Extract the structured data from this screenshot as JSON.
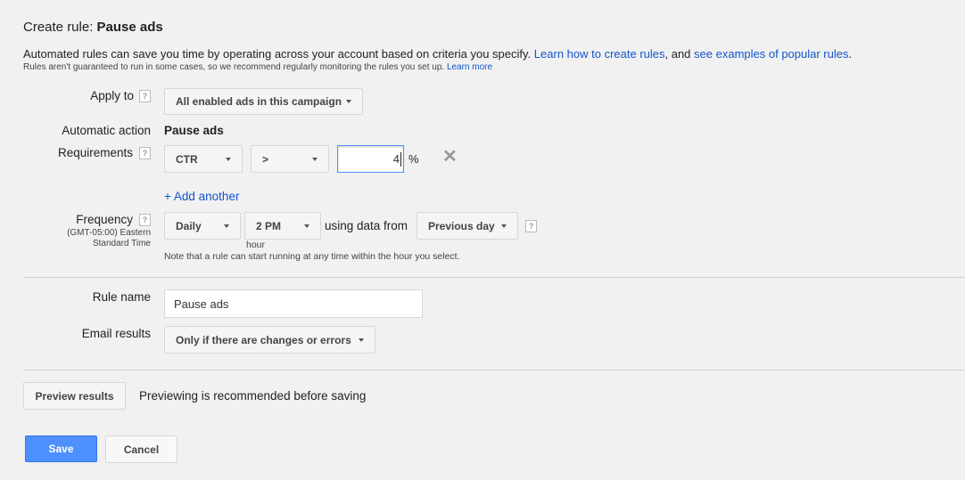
{
  "header": {
    "title_prefix": "Create rule: ",
    "title_name": "Pause ads",
    "description": "Automated rules can save you time by operating across your account based on criteria you specify.",
    "link_learn_create": "Learn how to create rules",
    "and_text": ", and",
    "link_examples": "see examples of popular rules",
    "period": ".",
    "subnote": "Rules aren't guaranteed to run in some cases, so we recommend regularly monitoring the rules you set up.",
    "subnote_link": "Learn more"
  },
  "apply_to": {
    "label": "Apply to",
    "help": "?",
    "value": "All enabled ads in this campaign"
  },
  "automatic_action": {
    "label": "Automatic action",
    "value": "Pause ads"
  },
  "requirements": {
    "label": "Requirements",
    "help": "?",
    "metric": "CTR",
    "operator": ">",
    "value": "4",
    "unit": "%",
    "add_another": "+ Add another"
  },
  "frequency": {
    "label": "Frequency",
    "help": "?",
    "timezone_line1": "(GMT-05:00) Eastern",
    "timezone_line2": "Standard Time",
    "period": "Daily",
    "time": "2 PM",
    "time_caption": "hour",
    "using_data_from": "using data from",
    "data_range": "Previous day",
    "data_help": "?",
    "note": "Note that a rule can start running at any time within the hour you select."
  },
  "rule_name": {
    "label": "Rule name",
    "value": "Pause ads"
  },
  "email_results": {
    "label": "Email results",
    "value": "Only if there are changes or errors"
  },
  "preview": {
    "button": "Preview results",
    "note": "Previewing is recommended before saving"
  },
  "footer": {
    "save": "Save",
    "cancel": "Cancel"
  },
  "colors": {
    "link": "#1155cc",
    "primary": "#4d90fe",
    "background": "#f1f1f1"
  }
}
